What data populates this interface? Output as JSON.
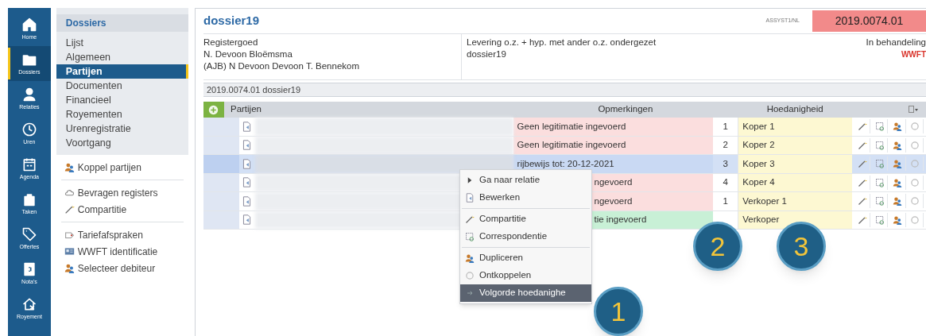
{
  "nav": [
    {
      "label": "Home",
      "selected": false
    },
    {
      "label": "Dossiers",
      "selected": true
    },
    {
      "label": "Relaties",
      "selected": false
    },
    {
      "label": "Uren",
      "selected": false
    },
    {
      "label": "Agenda",
      "selected": false
    },
    {
      "label": "Taken",
      "selected": false
    },
    {
      "label": "Offertes",
      "selected": false
    },
    {
      "label": "Nota's",
      "selected": false
    },
    {
      "label": "Royement",
      "selected": false
    }
  ],
  "side_panel": {
    "title": "Dossiers",
    "items": [
      {
        "label": "Lijst",
        "selected": false
      },
      {
        "label": "Algemeen",
        "selected": false
      },
      {
        "label": "Partijen",
        "selected": true
      },
      {
        "label": "Documenten",
        "selected": false
      },
      {
        "label": "Financieel",
        "selected": false
      },
      {
        "label": "Royementen",
        "selected": false
      },
      {
        "label": "Urenregistratie",
        "selected": false
      },
      {
        "label": "Voortgang",
        "selected": false
      }
    ],
    "action_groups": [
      [
        "Koppel partijen"
      ],
      [
        "Bevragen registers",
        "Compartitie"
      ],
      [
        "Tariefafspraken",
        "WWFT identificatie",
        "Selecteer debiteur"
      ]
    ]
  },
  "dossier": {
    "title": "dossier19",
    "office": "ASSYST1/NL",
    "number": "2019.0074.01",
    "info_left": [
      "Registergoed",
      "N. Devoon Bloëmsma",
      "(AJB) N Devoon Devoon T. Bennekom"
    ],
    "info_middle": [
      "Levering o.z. + hyp. met ander o.z. ondergezet",
      "dossier19"
    ],
    "status": "In behandeling",
    "flag": "WWFT",
    "breadcrumb": "2019.0074.01 dossier19"
  },
  "table": {
    "columns": [
      "Partijen",
      "Opmerkingen",
      "Hoedanigheid"
    ],
    "rows": [
      {
        "remark": "Geen legitimatie ingevoerd",
        "color": "#fbdede",
        "number": "1",
        "role": "Koper 1",
        "selected": false
      },
      {
        "remark": "Geen legitimatie ingevoerd",
        "color": "#fbdede",
        "number": "2",
        "role": "Koper 2",
        "selected": false
      },
      {
        "remark": "rijbewijs tot: 20-12-2021",
        "color": "#c9d9f3",
        "number": "3",
        "role": "Koper 3",
        "selected": true
      },
      {
        "remark": "ngevoerd",
        "color": "#fbdede",
        "number": "4",
        "role": "Koper 4",
        "selected": false
      },
      {
        "remark": "ngevoerd",
        "color": "#fbdede",
        "number": "1",
        "role": "Verkoper 1",
        "selected": false
      },
      {
        "remark": "tie ingevoerd",
        "color": "#c8f0d6",
        "role": "Verkoper",
        "selected": false
      }
    ]
  },
  "context_menu": {
    "groups": [
      [
        {
          "label": "Ga naar relatie",
          "selected": false
        },
        {
          "label": "Bewerken",
          "selected": false
        }
      ],
      [
        {
          "label": "Compartitie",
          "selected": false
        },
        {
          "label": "Correspondentie",
          "selected": false
        }
      ],
      [
        {
          "label": "Dupliceren",
          "selected": false
        },
        {
          "label": "Ontkoppelen",
          "selected": false
        },
        {
          "label": "Volgorde hoedanighe",
          "selected": true
        }
      ]
    ]
  },
  "callouts": [
    "1",
    "2",
    "3"
  ]
}
